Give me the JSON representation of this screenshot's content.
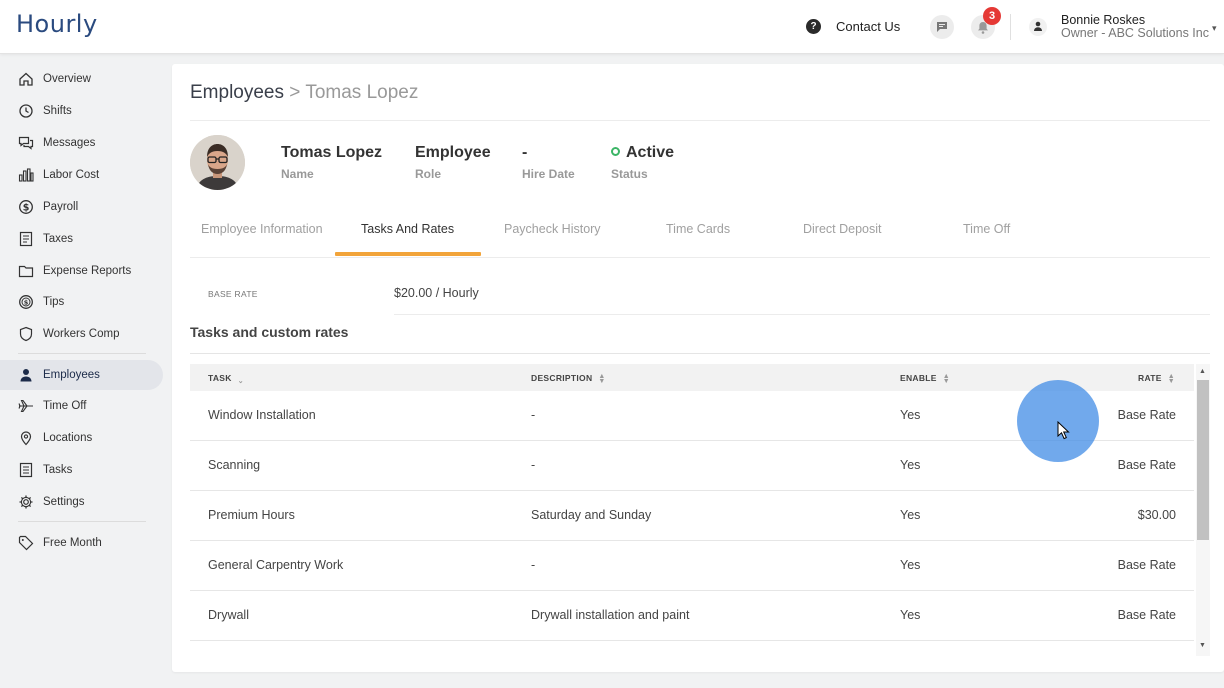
{
  "app": {
    "logo": "Hourly"
  },
  "header": {
    "help_icon": "?",
    "contact_label": "Contact Us",
    "notification_count": "3",
    "user_name": "Bonnie Roskes",
    "user_role": "Owner - ABC Solutions Inc",
    "user_caret": "▾"
  },
  "sidebar": {
    "items": [
      {
        "label": "Overview",
        "icon": "home-icon"
      },
      {
        "label": "Shifts",
        "icon": "clock-icon"
      },
      {
        "label": "Messages",
        "icon": "messages-icon"
      },
      {
        "label": "Labor Cost",
        "icon": "bar-chart-icon"
      },
      {
        "label": "Payroll",
        "icon": "dollar-icon"
      },
      {
        "label": "Taxes",
        "icon": "document-icon"
      },
      {
        "label": "Expense Reports",
        "icon": "folder-icon"
      },
      {
        "label": "Tips",
        "icon": "coin-icon"
      },
      {
        "label": "Workers Comp",
        "icon": "shield-icon"
      },
      {
        "label": "Employees",
        "icon": "person-icon"
      },
      {
        "label": "Time Off",
        "icon": "airplane-icon"
      },
      {
        "label": "Locations",
        "icon": "pin-icon"
      },
      {
        "label": "Tasks",
        "icon": "list-icon"
      },
      {
        "label": "Settings",
        "icon": "gear-icon"
      },
      {
        "label": "Free Month",
        "icon": "tag-icon"
      }
    ],
    "active": "Employees"
  },
  "breadcrumb": {
    "parent": "Employees",
    "separator": ">",
    "current": "Tomas Lopez"
  },
  "employee": {
    "name": "Tomas Lopez",
    "name_label": "Name",
    "role": "Employee",
    "role_label": "Role",
    "hire_date": "-",
    "hire_date_label": "Hire Date",
    "status": "Active",
    "status_label": "Status",
    "status_color": "#3bb566"
  },
  "tabs": [
    {
      "label": "Employee Information"
    },
    {
      "label": "Tasks And Rates"
    },
    {
      "label": "Paycheck History"
    },
    {
      "label": "Time Cards"
    },
    {
      "label": "Direct Deposit"
    },
    {
      "label": "Time Off"
    }
  ],
  "active_tab": "Tasks And Rates",
  "accent_color": "#f2a43a",
  "base_rate": {
    "label": "BASE RATE",
    "value": "$20.00 / Hourly"
  },
  "tasks_section": {
    "title": "Tasks and custom rates",
    "columns": [
      "TASK",
      "DESCRIPTION",
      "ENABLE",
      "RATE"
    ],
    "rows": [
      {
        "task": "Window Installation",
        "description": "-",
        "enable": "Yes",
        "rate": "Base Rate"
      },
      {
        "task": "Scanning",
        "description": "-",
        "enable": "Yes",
        "rate": "Base Rate"
      },
      {
        "task": "Premium Hours",
        "description": "Saturday and Sunday",
        "enable": "Yes",
        "rate": "$30.00"
      },
      {
        "task": "General Carpentry Work",
        "description": "-",
        "enable": "Yes",
        "rate": "Base Rate"
      },
      {
        "task": "Drywall",
        "description": "Drywall installation and paint",
        "enable": "Yes",
        "rate": "Base Rate"
      }
    ]
  }
}
